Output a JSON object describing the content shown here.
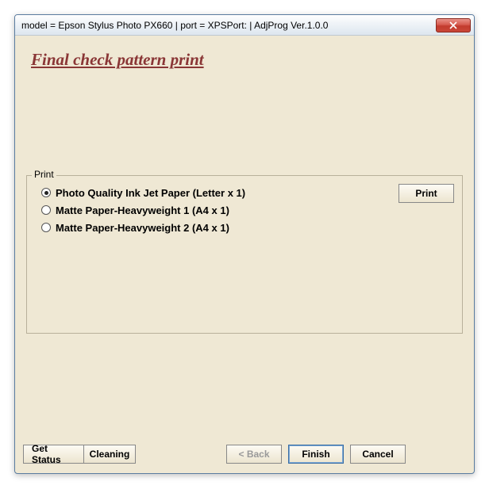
{
  "titlebar": {
    "text": "model = Epson Stylus Photo PX660 | port = XPSPort: | AdjProg Ver.1.0.0"
  },
  "heading": "Final check pattern print",
  "group": {
    "legend": "Print",
    "options": [
      "Photo Quality Ink Jet Paper (Letter x 1)",
      "Matte Paper-Heavyweight 1 (A4 x 1)",
      "Matte Paper-Heavyweight 2 (A4 x 1)"
    ],
    "selected": 0,
    "print_button": "Print"
  },
  "buttons": {
    "get_status": "Get Status",
    "cleaning": "Cleaning",
    "back": "< Back",
    "finish": "Finish",
    "cancel": "Cancel"
  }
}
